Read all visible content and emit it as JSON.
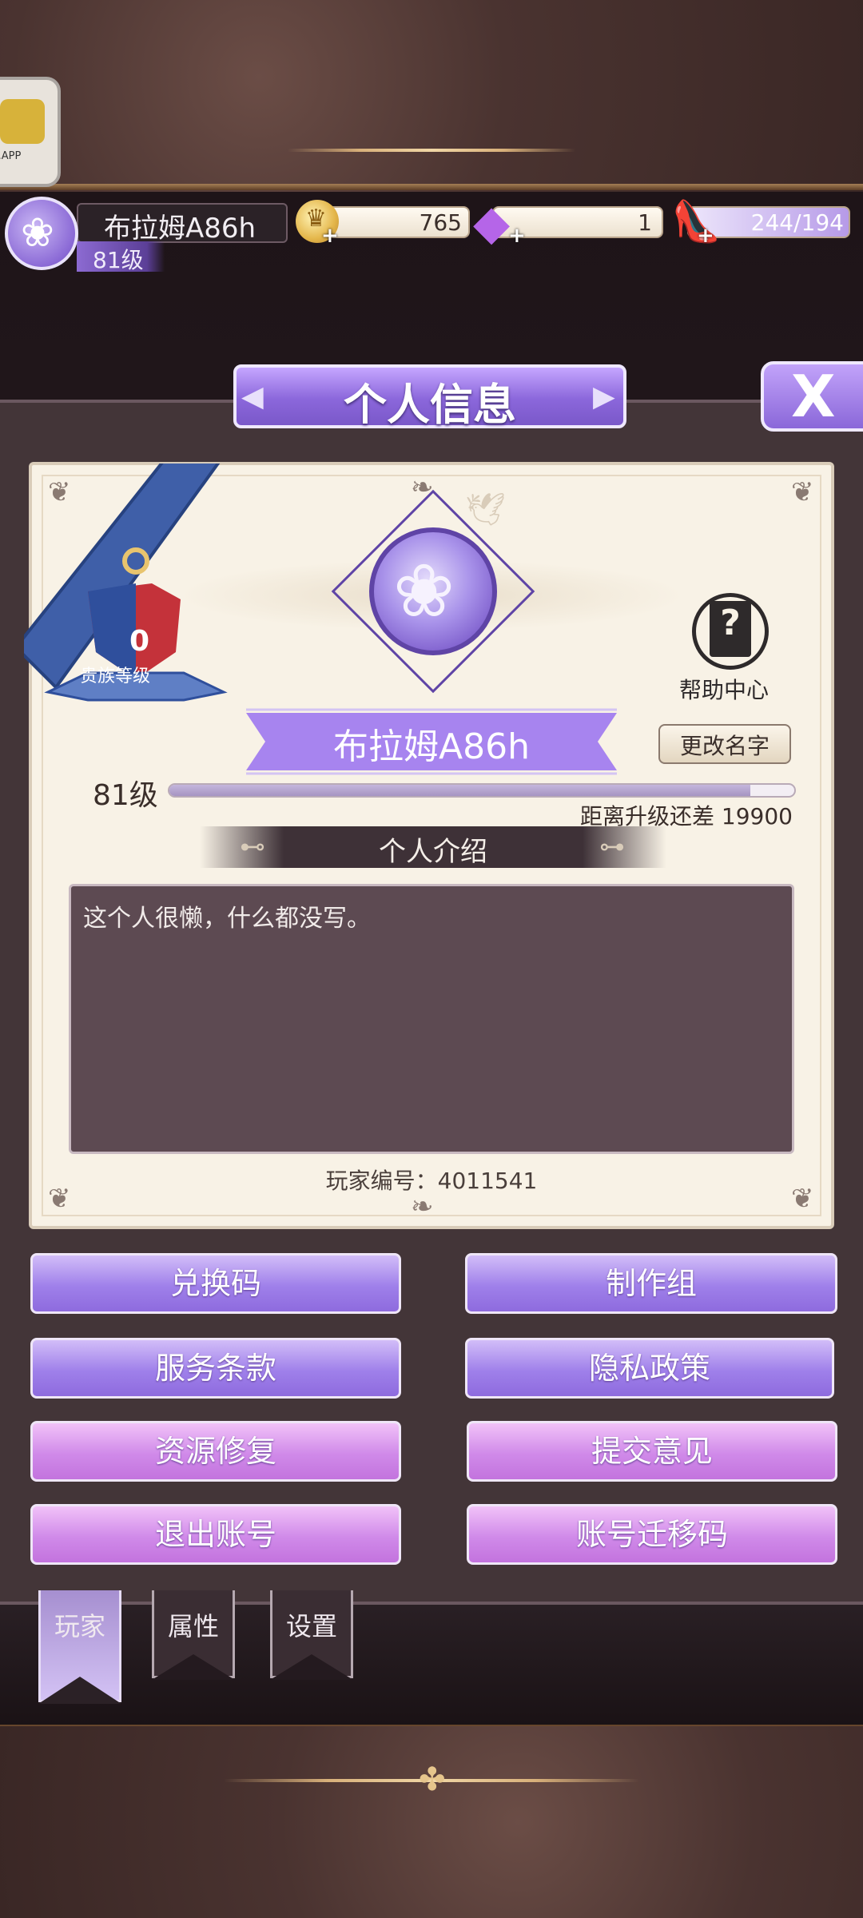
{
  "app_shortcut": {
    "label": "i.APP"
  },
  "topbar": {
    "player_name": "布拉姆A86h",
    "player_level": "81级",
    "gold": "765",
    "diamonds": "1",
    "stamina": "244/194"
  },
  "header": {
    "title": "个人信息",
    "close_label": "X"
  },
  "profile": {
    "nobility_level": "0",
    "nobility_label": "贵族等级",
    "help_label": "帮助中心",
    "help_icon": "?",
    "name": "布拉姆A86h",
    "rename_label": "更改名字",
    "level_label": "81级",
    "xp_progress_fraction": 0.93,
    "xp_remaining_text": "距离升级还差 19900",
    "intro_title": "个人介绍",
    "intro_text": "这个人很懒，什么都没写。",
    "player_id_text": "玩家编号：4011541"
  },
  "actions": {
    "redeem_code": "兑换码",
    "credits": "制作组",
    "terms": "服务条款",
    "privacy": "隐私政策",
    "repair": "资源修复",
    "feedback": "提交意见",
    "logout": "退出账号",
    "migration_code": "账号迁移码"
  },
  "tabs": [
    {
      "label": "玩家",
      "active": true
    },
    {
      "label": "属性",
      "active": false
    },
    {
      "label": "设置",
      "active": false
    }
  ],
  "colors": {
    "accent_purple": "#8b67db",
    "accent_pink": "#d08ae9",
    "panel": "#433538",
    "paper": "#f8f2e6"
  }
}
